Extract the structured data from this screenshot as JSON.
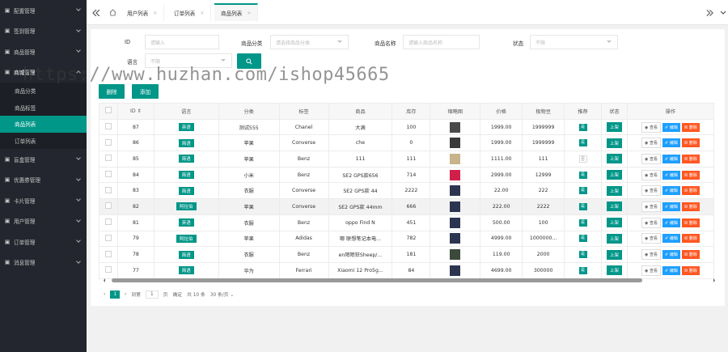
{
  "sidebar": {
    "items": [
      {
        "label": "配置管理",
        "icon": "settings-icon",
        "expanded": false
      },
      {
        "label": "签到管理",
        "icon": "calendar-icon",
        "expanded": false
      },
      {
        "label": "商品管理",
        "icon": "goods-icon",
        "expanded": false
      },
      {
        "label": "商城管理",
        "icon": "mall-icon",
        "expanded": true
      },
      {
        "label": "盲盒管理",
        "icon": "box-icon",
        "expanded": false
      },
      {
        "label": "优惠券管理",
        "icon": "coupon-icon",
        "expanded": false
      },
      {
        "label": "卡片管理",
        "icon": "card-icon",
        "expanded": false
      },
      {
        "label": "用户管理",
        "icon": "user-icon",
        "expanded": false
      },
      {
        "label": "订单管理",
        "icon": "order-icon",
        "expanded": false
      },
      {
        "label": "消息管理",
        "icon": "message-icon",
        "expanded": false
      }
    ],
    "sub_items": [
      "商品分类",
      "商品标签",
      "商品列表",
      "订单列表"
    ],
    "active_sub": "商品列表"
  },
  "topbar": {
    "tabs": [
      {
        "label": "用户列表",
        "active": false
      },
      {
        "label": "订单列表",
        "active": false
      },
      {
        "label": "商品列表",
        "active": true
      }
    ]
  },
  "filters": {
    "id_label": "ID",
    "id_placeholder": "请输入",
    "category_label": "商品分类",
    "category_placeholder": "请选择商品分类",
    "name_label": "商品名称",
    "name_placeholder": "请输入商品名称",
    "status_label": "状态",
    "status_value": "不限",
    "lang_label": "语言",
    "lang_value": "不限"
  },
  "actions": {
    "delete": "删除",
    "add": "添加"
  },
  "watermark": "https://www.huzhan.com/ishop45665",
  "table": {
    "columns": [
      "ID",
      "语言",
      "分类",
      "标签",
      "商品",
      "库存",
      "缩略图",
      "价格",
      "极物豆",
      "推荐",
      "状态",
      "操作"
    ],
    "rows": [
      {
        "id": "87",
        "lang": "英语",
        "cat": "测试555",
        "tag": "Chanel",
        "name": "大满",
        "stock": "100",
        "price": "1999.00",
        "beans": "1999999",
        "rec": "是",
        "status": "上架",
        "thumb": "#4a4a4a"
      },
      {
        "id": "86",
        "lang": "简语",
        "cat": "苹果",
        "tag": "Converse",
        "name": "che",
        "stock": "0",
        "price": "1999.00",
        "beans": "1999999",
        "rec": "是",
        "status": "上架",
        "thumb": "#3a3a3a"
      },
      {
        "id": "85",
        "lang": "简语",
        "cat": "苹果",
        "tag": "Benz",
        "name": "111",
        "stock": "111",
        "price": "1111.00",
        "beans": "111",
        "rec": "否",
        "status": "上架",
        "thumb": "#c8b38a"
      },
      {
        "id": "84",
        "lang": "简语",
        "cat": "小米",
        "tag": "Benz",
        "name": "SE2 GPS款656",
        "stock": "714",
        "price": "2999.00",
        "beans": "12999",
        "rec": "是",
        "status": "上架",
        "thumb": "#d0204a"
      },
      {
        "id": "83",
        "lang": "简语",
        "cat": "衣服",
        "tag": "Converse",
        "name": "SE2 GPS款 44",
        "stock": "2222",
        "price": "22.00",
        "beans": "222",
        "rec": "是",
        "status": "上架",
        "thumb": "#2c3550"
      },
      {
        "id": "82",
        "lang": "阿拉伯",
        "cat": "苹果",
        "tag": "Converse",
        "name": "SE2 GPS款 44mm",
        "stock": "666",
        "price": "222.00",
        "beans": "2222",
        "rec": "是",
        "status": "上架",
        "thumb": "#2c3550"
      },
      {
        "id": "81",
        "lang": "英语",
        "cat": "衣服",
        "tag": "Benz",
        "name": "oppo Find N",
        "stock": "451",
        "price": "500.00",
        "beans": "100",
        "rec": "是",
        "status": "上架",
        "thumb": "#2c3550"
      },
      {
        "id": "79",
        "lang": "阿拉伯",
        "cat": "苹果",
        "tag": "Adidas",
        "name": "哪 联想笔记本电...",
        "stock": "782",
        "price": "4999.00",
        "beans": "1000000...",
        "rec": "是",
        "status": "上架",
        "thumb": "#2c3550"
      },
      {
        "id": "78",
        "lang": "简语",
        "cat": "衣服",
        "tag": "Benz",
        "name": "en陌陌狂Sheep/...",
        "stock": "181",
        "price": "119.00",
        "beans": "2000",
        "rec": "是",
        "status": "上架",
        "thumb": "#3b4a3a"
      },
      {
        "id": "77",
        "lang": "简语",
        "cat": "华为",
        "tag": "Ferrari",
        "name": "Xiaomi 12 Pro5g...",
        "stock": "84",
        "price": "4699.00",
        "beans": "300000",
        "rec": "是",
        "status": "上架",
        "thumb": "#2c3550"
      }
    ],
    "op_view": "查看",
    "op_edit": "编辑",
    "op_delete": "删除"
  },
  "pager": {
    "current": "1",
    "goto": "到第",
    "page_input": "1",
    "page_unit": "页",
    "confirm": "确定",
    "total": "共 10 条",
    "per_page": "30 条/页"
  }
}
